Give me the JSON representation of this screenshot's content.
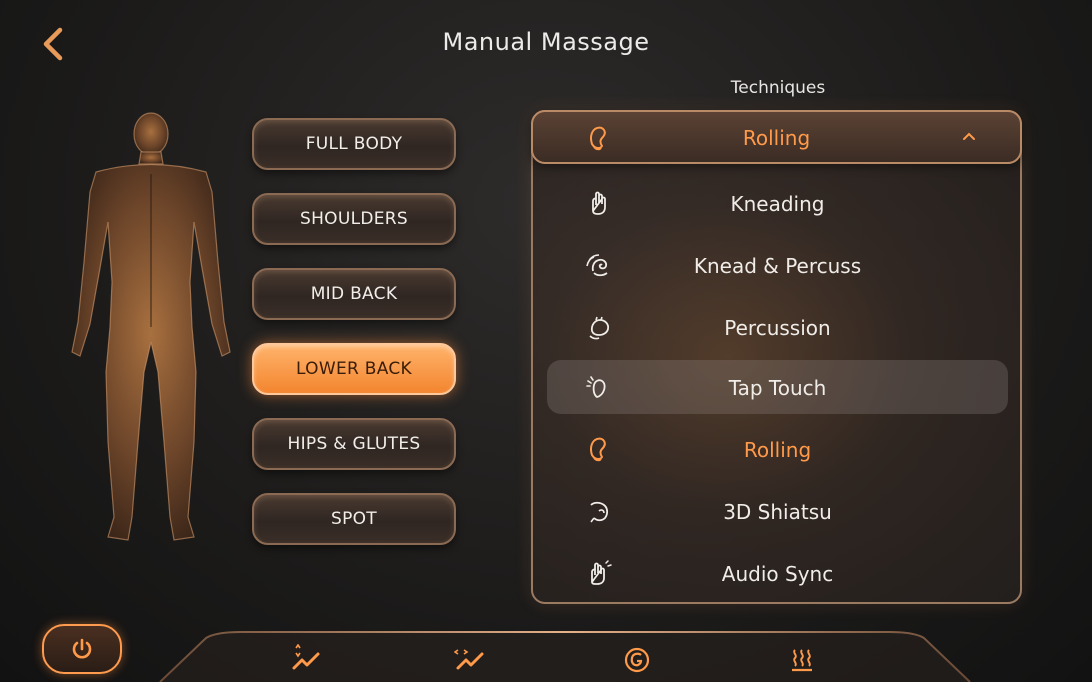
{
  "header": {
    "title": "Manual Massage",
    "back_icon": "chevron-left-icon"
  },
  "regions": [
    {
      "label": "FULL BODY",
      "active": false
    },
    {
      "label": "SHOULDERS",
      "active": false
    },
    {
      "label": "MID BACK",
      "active": false
    },
    {
      "label": "LOWER BACK",
      "active": true
    },
    {
      "label": "HIPS & GLUTES",
      "active": false
    },
    {
      "label": "SPOT",
      "active": false
    }
  ],
  "techniques": {
    "label": "Techniques",
    "selected": "Rolling",
    "items": [
      {
        "label": "Kneading",
        "icon": "kneading-hand-icon"
      },
      {
        "label": "Knead & Percuss",
        "icon": "knead-percuss-hand-icon"
      },
      {
        "label": "Percussion",
        "icon": "percussion-hand-icon"
      },
      {
        "label": "Tap Touch",
        "icon": "tap-touch-hand-icon"
      },
      {
        "label": "Rolling",
        "icon": "rolling-hand-icon"
      },
      {
        "label": "3D Shiatsu",
        "icon": "shiatsu-hand-icon"
      },
      {
        "label": "Audio Sync",
        "icon": "audio-sync-hand-icon"
      }
    ]
  },
  "bottom_nav": {
    "items": [
      {
        "icon": "power-icon"
      },
      {
        "icon": "speed-adjust-icon"
      },
      {
        "icon": "width-adjust-icon"
      },
      {
        "icon": "gravity-icon"
      },
      {
        "icon": "heat-icon"
      }
    ]
  },
  "colors": {
    "accent": "#ff9a4a",
    "active_button": "#f3852f",
    "background": "#1c1b1a"
  }
}
